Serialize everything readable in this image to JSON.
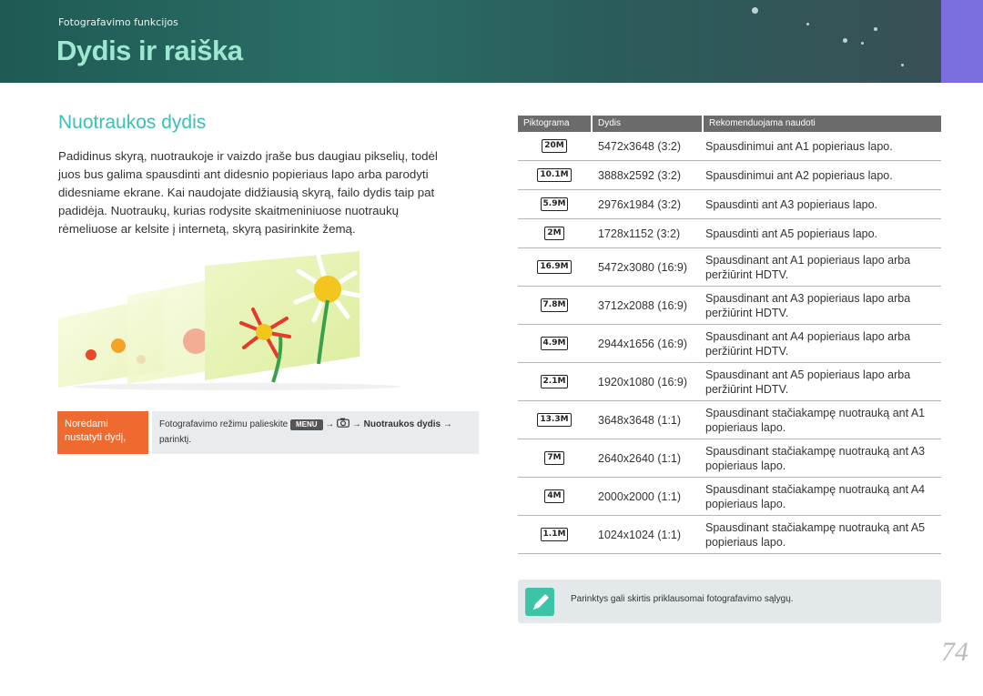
{
  "header": {
    "section": "Fotografavimo funkcijos",
    "title": "Dydis ir raiška"
  },
  "main": {
    "subtitle": "Nuotraukos dydis",
    "intro": "Padidinus skyrą, nuotraukoje ir vaizdo įraše bus daugiau pikselių, todėl juos bus galima spausdinti ant didesnio popieriaus lapo arba parodyti didesniame ekrane. Kai naudojate didžiausią skyrą, failo dydis taip pat padidėja. Nuotraukų, kurias rodysite skaitmeniniuose nuotraukų rėmeliuose ar kelsite į internetą, skyrą pasirinkite žemą."
  },
  "tip": {
    "label": "Norėdami nustatyti dydį,",
    "text_before": "Fotografavimo režimu palieskite",
    "menu_key": "MENU",
    "arrow1": "→",
    "arrow2": "→",
    "bold_part": "Nuotraukos dydis",
    "arrow3": "→",
    "text_after": "parinktį."
  },
  "table": {
    "headers": [
      "Piktograma",
      "Dydis",
      "Rekomenduojama naudoti"
    ],
    "rows": [
      {
        "icon": "20M",
        "size": "5472x3648 (3:2)",
        "use": "Spausdinimui ant A1 popieriaus lapo."
      },
      {
        "icon": "10.1M",
        "size": "3888x2592 (3:2)",
        "use": "Spausdinimui ant A2 popieriaus lapo."
      },
      {
        "icon": "5.9M",
        "size": "2976x1984 (3:2)",
        "use": "Spausdinti ant A3 popieriaus lapo."
      },
      {
        "icon": "2M",
        "size": "1728x1152 (3:2)",
        "use": "Spausdinti ant A5 popieriaus lapo."
      },
      {
        "icon": "16.9M",
        "size": "5472x3080 (16:9)",
        "use": "Spausdinant ant A1 popieriaus lapo arba peržiūrint HDTV."
      },
      {
        "icon": "7.8M",
        "size": "3712x2088 (16:9)",
        "use": "Spausdinant ant A3 popieriaus lapo arba peržiūrint HDTV."
      },
      {
        "icon": "4.9M",
        "size": "2944x1656 (16:9)",
        "use": "Spausdinant ant A4 popieriaus lapo arba peržiūrint HDTV."
      },
      {
        "icon": "2.1M",
        "size": "1920x1080 (16:9)",
        "use": "Spausdinant ant A5 popieriaus lapo arba peržiūrint HDTV."
      },
      {
        "icon": "13.3M",
        "size": "3648x3648 (1:1)",
        "use": "Spausdinant stačiakampę nuotrauką ant A1 popieriaus lapo."
      },
      {
        "icon": "7M",
        "size": "2640x2640 (1:1)",
        "use": "Spausdinant stačiakampę nuotrauką ant A3 popieriaus lapo."
      },
      {
        "icon": "4M",
        "size": "2000x2000 (1:1)",
        "use": "Spausdinant stačiakampę nuotrauką ant A4 popieriaus lapo."
      },
      {
        "icon": "1.1M",
        "size": "1024x1024 (1:1)",
        "use": "Spausdinant stačiakampę nuotrauką ant A5 popieriaus lapo."
      }
    ]
  },
  "note": {
    "icon": "pencil-note-icon",
    "text": "Parinktys gali skirtis priklausomai fotografavimo sąlygų."
  },
  "page_number": "74",
  "colors": {
    "title": "#9ee8d2",
    "subtitle": "#3bbfb6",
    "tip_label": "#ee6a2f",
    "accent_tab": "#7b6fe0"
  }
}
